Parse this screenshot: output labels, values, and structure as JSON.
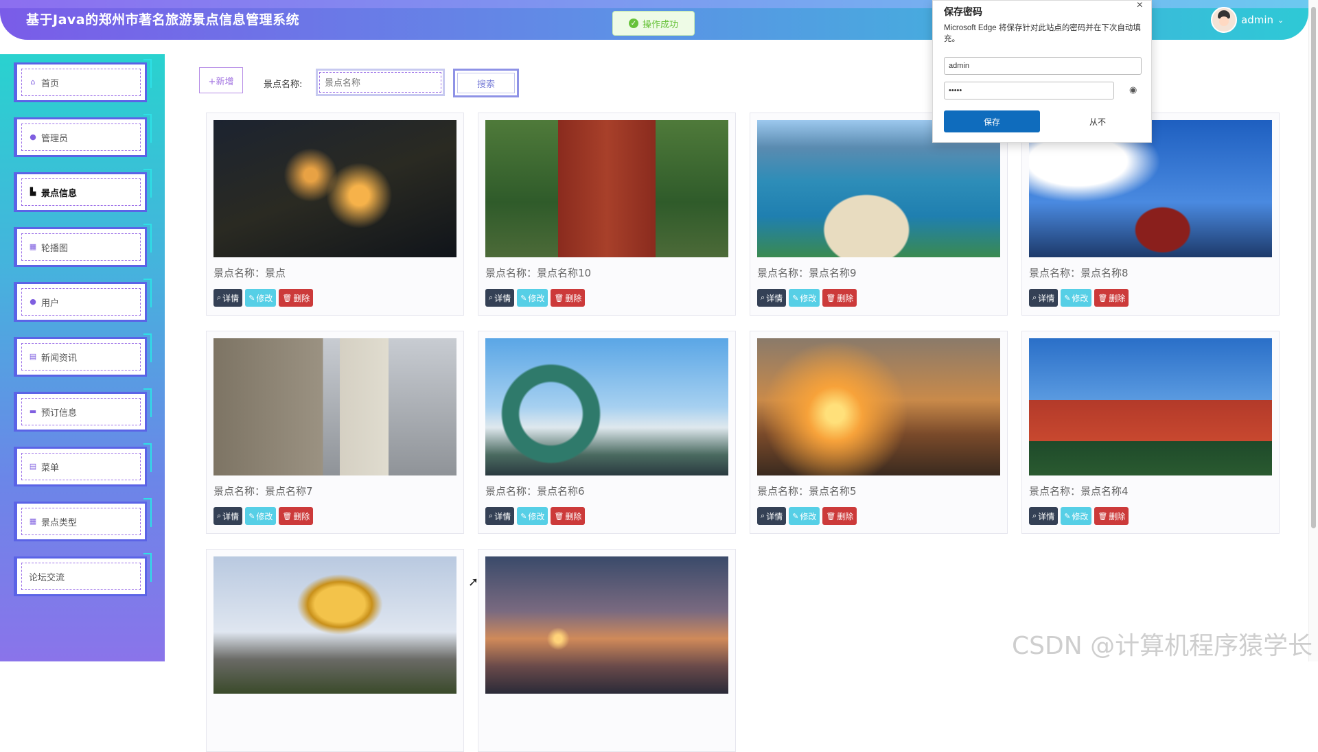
{
  "header": {
    "title": "基于Java的郑州市著名旅游景点信息管理系统",
    "toast": "操作成功",
    "username": "admin"
  },
  "sidebar": {
    "items": [
      {
        "label": "首页",
        "icon": "home-icon",
        "glyph": "⌂"
      },
      {
        "label": "管理员",
        "icon": "user-icon",
        "glyph": "●"
      },
      {
        "label": "景点信息",
        "icon": "scenic-icon",
        "glyph": "▙",
        "active": true
      },
      {
        "label": "轮播图",
        "icon": "carousel-icon",
        "glyph": "▦"
      },
      {
        "label": "用户",
        "icon": "user-icon",
        "glyph": "●"
      },
      {
        "label": "新闻资讯",
        "icon": "news-icon",
        "glyph": "▤"
      },
      {
        "label": "预订信息",
        "icon": "booking-icon",
        "glyph": "▬"
      },
      {
        "label": "菜单",
        "icon": "menu-icon",
        "glyph": "▤"
      },
      {
        "label": "景点类型",
        "icon": "grid-icon",
        "glyph": "▦"
      },
      {
        "label": "论坛交流",
        "icon": "",
        "glyph": ""
      }
    ]
  },
  "toolbar": {
    "add_label": "+新增",
    "search_label": "景点名称:",
    "search_placeholder": "景点名称",
    "search_button": "搜索"
  },
  "cards": [
    {
      "name": "景点名称：景点",
      "photo": "night-resort-photo"
    },
    {
      "name": "景点名称：景点名称10",
      "photo": "pagoda-photo"
    },
    {
      "name": "景点名称：景点名称9",
      "photo": "beach-bay-photo"
    },
    {
      "name": "景点名称：景点名称8",
      "photo": "temple-of-heaven-photo"
    },
    {
      "name": "景点名称：景点名称7",
      "photo": "leaning-tower-photo"
    },
    {
      "name": "景点名称：景点名称6",
      "photo": "ring-sculpture-photo"
    },
    {
      "name": "景点名称：景点名称5",
      "photo": "sunset-pavilion-photo"
    },
    {
      "name": "景点名称：景点名称4",
      "photo": "tiananmen-photo"
    },
    {
      "name": "",
      "photo": "golden-lotus-photo"
    },
    {
      "name": "",
      "photo": "pier-sunset-photo"
    }
  ],
  "card_actions": {
    "detail": "详情",
    "edit": "修改",
    "delete": "删除"
  },
  "password_dialog": {
    "title": "保存密码",
    "description": "Microsoft Edge 将保存针对此站点的密码并在下次自动填充。",
    "username": "admin",
    "password_mask": "•••••",
    "save": "保存",
    "never": "从不"
  },
  "watermark": "CSDN @计算机程序猿学长",
  "colors": {
    "primary": "#5b63e6",
    "success": "#67c23a",
    "detail": "#344055",
    "edit": "#56cfe6",
    "delete": "#cc3a3a",
    "edge_blue": "#0f6cbd"
  }
}
